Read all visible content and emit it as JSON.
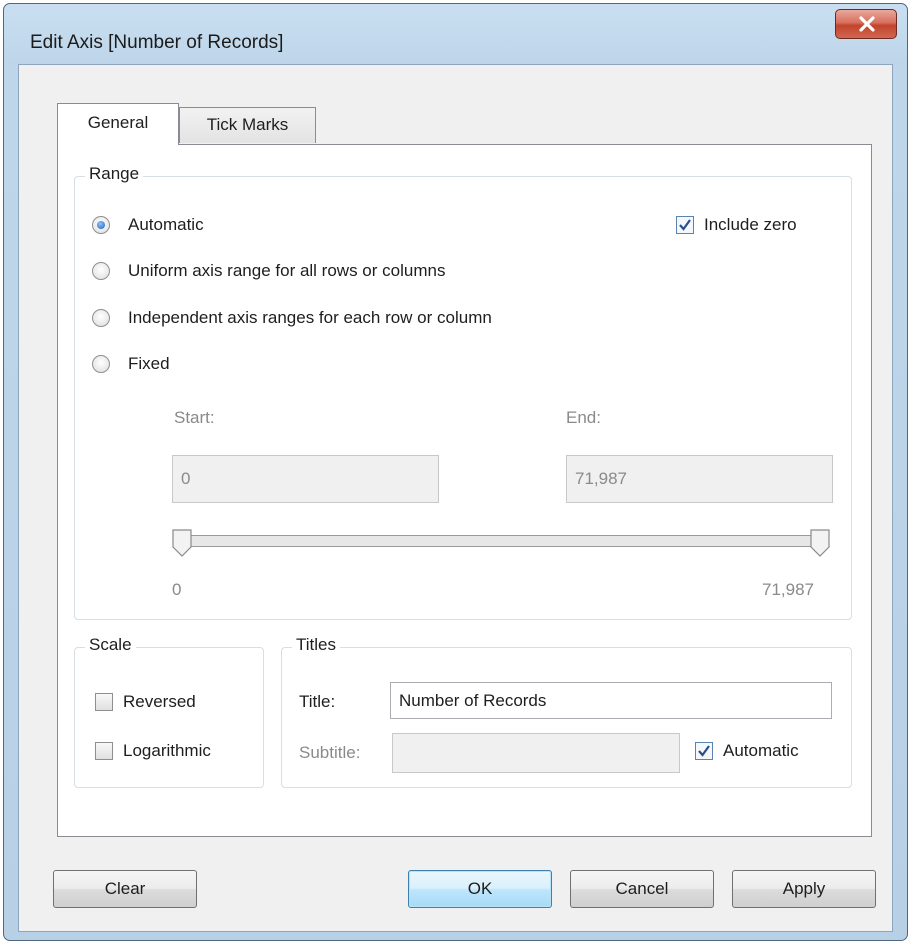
{
  "window": {
    "title": "Edit Axis [Number of Records]"
  },
  "tabs": [
    {
      "label": "General",
      "active": true
    },
    {
      "label": "Tick Marks",
      "active": false
    }
  ],
  "range": {
    "group_label": "Range",
    "options": [
      {
        "label": "Automatic",
        "selected": true
      },
      {
        "label": "Uniform axis range for all rows or columns",
        "selected": false
      },
      {
        "label": "Independent axis ranges for each row or column",
        "selected": false
      },
      {
        "label": "Fixed",
        "selected": false
      }
    ],
    "include_zero": {
      "label": "Include zero",
      "checked": true
    },
    "start_label": "Start:",
    "end_label": "End:",
    "start_value": "0",
    "end_value": "71,987",
    "slider_min_label": "0",
    "slider_max_label": "71,987"
  },
  "scale": {
    "group_label": "Scale",
    "reversed": {
      "label": "Reversed",
      "checked": false
    },
    "logarithmic": {
      "label": "Logarithmic",
      "checked": false
    }
  },
  "titles": {
    "group_label": "Titles",
    "title_label": "Title:",
    "title_value": "Number of Records",
    "subtitle_label": "Subtitle:",
    "subtitle_value": "",
    "automatic": {
      "label": "Automatic",
      "checked": true
    }
  },
  "buttons": {
    "clear": "Clear",
    "ok": "OK",
    "cancel": "Cancel",
    "apply": "Apply"
  },
  "colors": {
    "titlebar": "#bfd6ea",
    "close_button": "#c1432d",
    "default_button_border": "#3c7fb1",
    "radio_selected": "#1f5fb2"
  }
}
